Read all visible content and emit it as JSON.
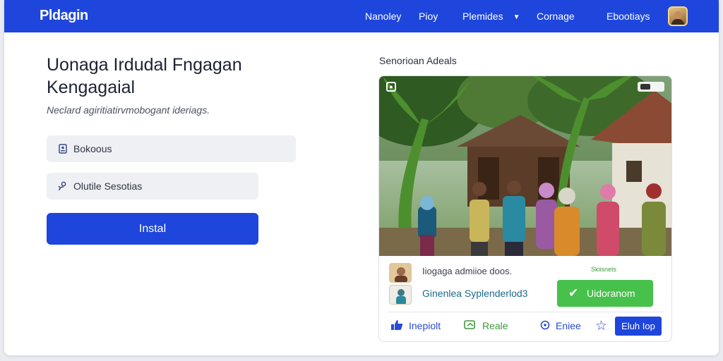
{
  "header": {
    "brand": "Pldagin",
    "nav": [
      "Nanoley",
      "Pioy",
      "Plemides",
      "Cornage",
      "Ebootiays"
    ]
  },
  "hero": {
    "title_line1": "Uonaga Irdudal Fngagan",
    "title_line2": "Kengagaial",
    "subtitle": "Neclard agiritiatirvmobogant ideriags."
  },
  "fields": [
    {
      "label": "Bokoous",
      "icon": "id-card-icon"
    },
    {
      "label": "Olutile Sesotias",
      "icon": "user-icon"
    }
  ],
  "install_label": "Instal",
  "card": {
    "heading": "Senorioan Adeals",
    "meta_top": "Iiogaga admiioe doos.",
    "meta_bottom": "Ginenlea Syplenderlod3",
    "status_caption": "Skiisnets",
    "status_button": "Uidoranom",
    "actions": [
      {
        "label": "Inepiolt",
        "icon": "thumbs-up-icon",
        "color": "#2b4bd0"
      },
      {
        "label": "Reale",
        "icon": "share-icon",
        "color": "#3d9a3f"
      },
      {
        "label": "Eniee",
        "icon": "location-pin-icon",
        "color": "#2b4bd0"
      }
    ],
    "follow_button": "Eluh Iop"
  }
}
